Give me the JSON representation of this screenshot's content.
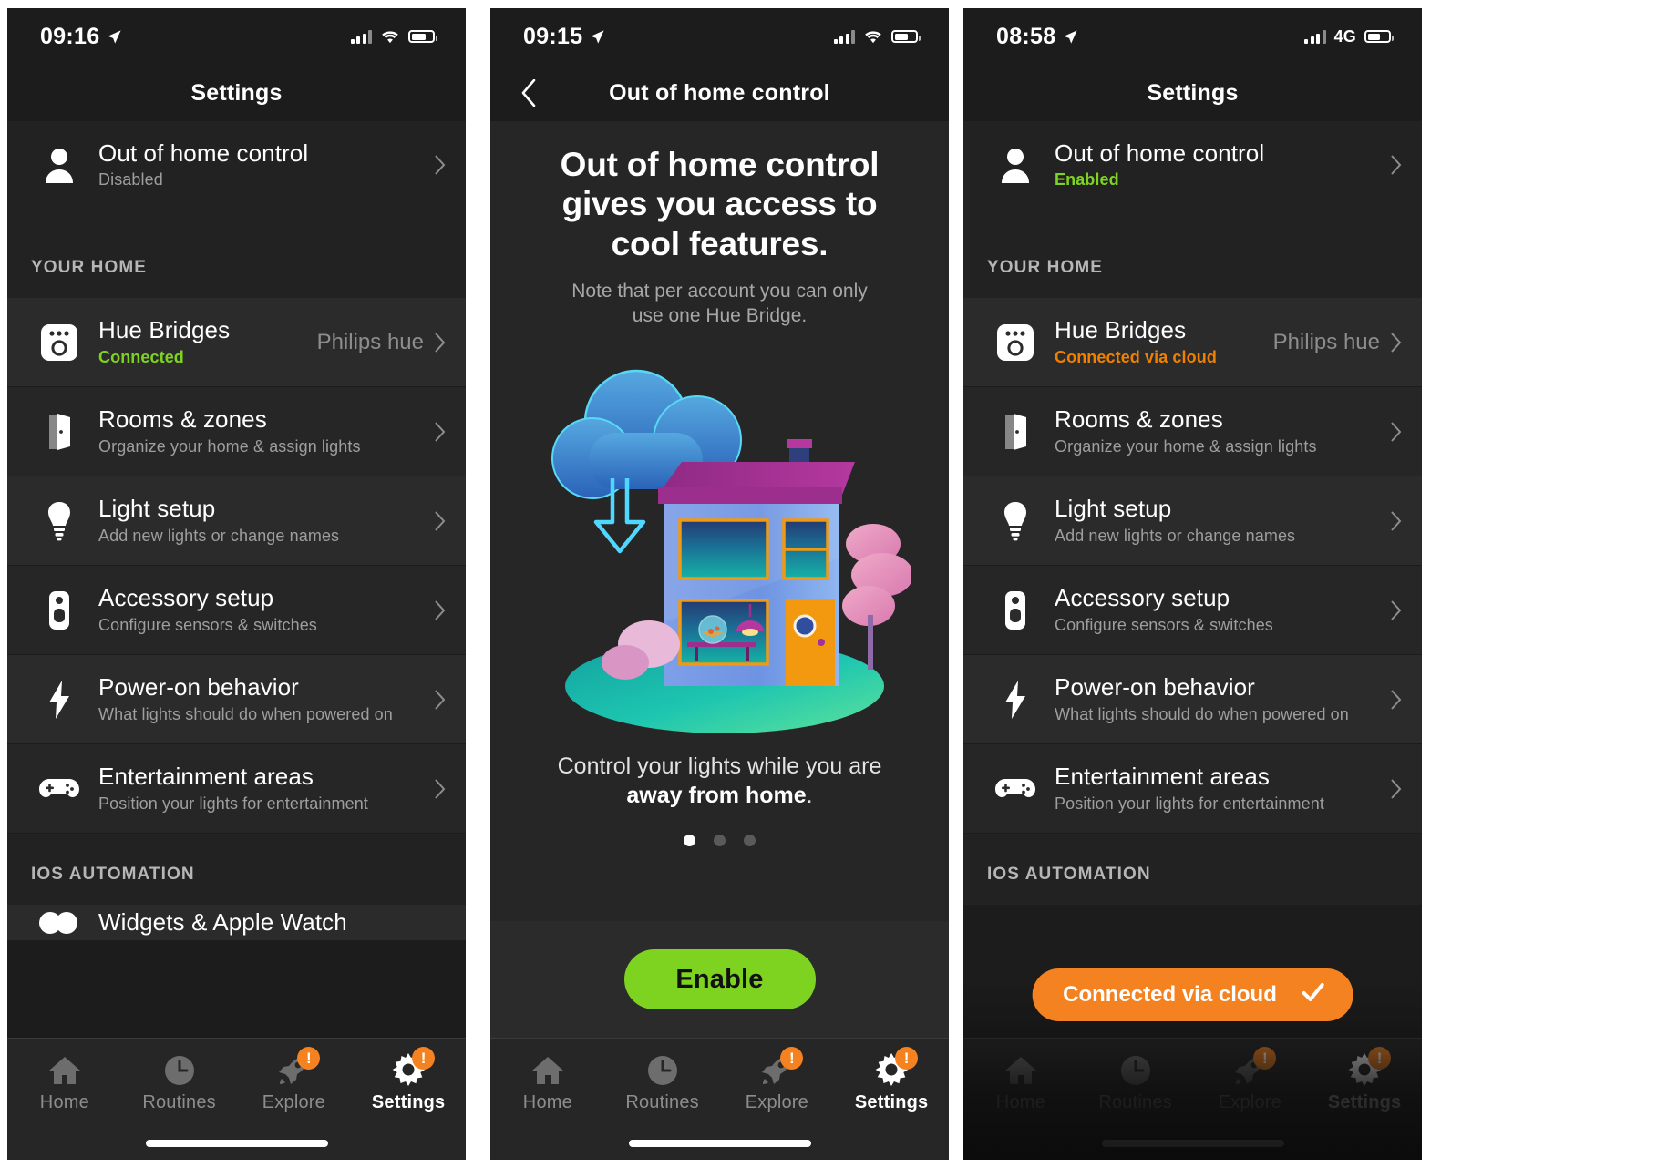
{
  "screens": [
    {
      "id": "settings-disabled",
      "status": {
        "time": "09:16",
        "network": "",
        "signal_icon": "cellular-bars-icon",
        "wifi": true,
        "battery": 70
      },
      "nav": {
        "title": "Settings",
        "has_back": false
      },
      "account_row": {
        "title": "Out of home control",
        "status": "Disabled",
        "status_color": "#9e9e9e",
        "icon": "person-icon"
      },
      "section_label": "YOUR HOME",
      "items": [
        {
          "icon": "hue-bridge-icon",
          "title": "Hue Bridges",
          "subtitle": "Connected",
          "subtitle_color": "#7ed321",
          "value": "Philips hue"
        },
        {
          "icon": "door-icon",
          "title": "Rooms & zones",
          "subtitle": "Organize your home & assign lights",
          "subtitle_color": "#9e9e9e",
          "value": ""
        },
        {
          "icon": "bulb-icon",
          "title": "Light setup",
          "subtitle": "Add new lights or change names",
          "subtitle_color": "#9e9e9e",
          "value": ""
        },
        {
          "icon": "remote-icon",
          "title": "Accessory setup",
          "subtitle": "Configure sensors & switches",
          "subtitle_color": "#9e9e9e",
          "value": ""
        },
        {
          "icon": "bolt-icon",
          "title": "Power-on behavior",
          "subtitle": "What lights should do when powered on",
          "subtitle_color": "#9e9e9e",
          "value": ""
        },
        {
          "icon": "gamepad-icon",
          "title": "Entertainment areas",
          "subtitle": "Position your lights for entertainment",
          "subtitle_color": "#9e9e9e",
          "value": ""
        }
      ],
      "section_label_2": "IOS AUTOMATION",
      "clipped_item": {
        "icon": "widgets-icon",
        "title": "Widgets & Apple Watch"
      },
      "toast": null
    },
    {
      "id": "out-of-home-promo",
      "status": {
        "time": "09:15",
        "network": "",
        "signal_icon": "cellular-bars-icon",
        "wifi": true,
        "battery": 66
      },
      "nav": {
        "title": "Out of home control",
        "has_back": true
      },
      "headline": "Out of home control gives you access to cool features.",
      "subhead": "Note that per account you can only use one Hue Bridge.",
      "caption_plain_1": "Control your lights while you are ",
      "caption_bold": "away from home",
      "caption_plain_2": ".",
      "pager": {
        "total": 3,
        "active": 0
      },
      "cta_label": "Enable"
    },
    {
      "id": "settings-enabled",
      "status": {
        "time": "08:58",
        "network": "4G",
        "signal_icon": "cellular-bars-icon",
        "wifi": false,
        "battery": 62
      },
      "nav": {
        "title": "Settings",
        "has_back": false
      },
      "account_row": {
        "title": "Out of home control",
        "status": "Enabled",
        "status_color": "#7ed321",
        "icon": "person-icon"
      },
      "section_label": "YOUR HOME",
      "items": [
        {
          "icon": "hue-bridge-icon",
          "title": "Hue Bridges",
          "subtitle": "Connected via cloud",
          "subtitle_color": "#f08000",
          "value": "Philips hue"
        },
        {
          "icon": "door-icon",
          "title": "Rooms & zones",
          "subtitle": "Organize your home & assign lights",
          "subtitle_color": "#9e9e9e",
          "value": ""
        },
        {
          "icon": "bulb-icon",
          "title": "Light setup",
          "subtitle": "Add new lights or change names",
          "subtitle_color": "#9e9e9e",
          "value": ""
        },
        {
          "icon": "remote-icon",
          "title": "Accessory setup",
          "subtitle": "Configure sensors & switches",
          "subtitle_color": "#9e9e9e",
          "value": ""
        },
        {
          "icon": "bolt-icon",
          "title": "Power-on behavior",
          "subtitle": "What lights should do when powered on",
          "subtitle_color": "#9e9e9e",
          "value": ""
        },
        {
          "icon": "gamepad-icon",
          "title": "Entertainment areas",
          "subtitle": "Position your lights for entertainment",
          "subtitle_color": "#9e9e9e",
          "value": ""
        }
      ],
      "section_label_2": "IOS AUTOMATION",
      "toast": {
        "label": "Connected via cloud",
        "icon": "check-icon",
        "color": "#f58220"
      }
    }
  ],
  "tabbar": {
    "tabs": [
      {
        "label": "Home",
        "icon": "house-icon",
        "badge": "",
        "active": false
      },
      {
        "label": "Routines",
        "icon": "clock-icon",
        "badge": "",
        "active": false
      },
      {
        "label": "Explore",
        "icon": "rocket-icon",
        "badge": "!",
        "active": false
      },
      {
        "label": "Settings",
        "icon": "gear-icon",
        "badge": "!",
        "active": true
      }
    ]
  },
  "colors": {
    "accent_green": "#7ed321",
    "accent_orange": "#f58220",
    "warn_orange": "#f08000",
    "bg": "#1c1c1c",
    "row_bg": "#2b2b2b"
  }
}
